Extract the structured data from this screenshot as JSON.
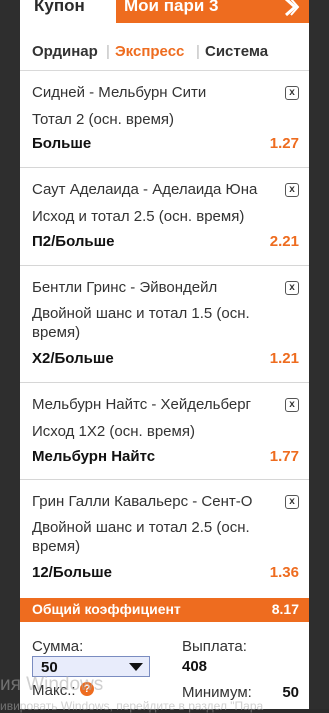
{
  "tabs": {
    "coupon": "Купон",
    "my_bets": "Мои пари 3"
  },
  "modes": {
    "single": "Ординар",
    "express": "Экспресс",
    "system": "Система",
    "active": "express"
  },
  "bets": [
    {
      "match": "Сидней - Мельбурн Сити",
      "market": "Тотал 2 (осн. время)",
      "pick": "Больше",
      "odds": "1.27"
    },
    {
      "match": "Саут Аделаида - Аделаида Юна",
      "market": "Исход и тотал 2.5 (осн. время)",
      "pick": "П2/Больше",
      "odds": "2.21"
    },
    {
      "match": "Бентли Гринс - Эйвондейл",
      "market": "Двойной шанс и тотал 1.5 (осн. время)",
      "pick": "Х2/Больше",
      "odds": "1.21"
    },
    {
      "match": "Мельбурн Найтс - Хейдельберг",
      "market": "Исход 1Х2 (осн. время)",
      "pick": "Мельбурн Найтс",
      "odds": "1.77"
    },
    {
      "match": "Грин Галли Кавальерс - Сент-О",
      "market": "Двойной шанс и тотал 2.5 (осн. время)",
      "pick": "12/Больше",
      "odds": "1.36"
    }
  ],
  "close_glyph": "x",
  "total": {
    "label": "Общий коэффициент",
    "value": "8.17"
  },
  "stake": {
    "sum_label": "Сумма:",
    "sum_value": "50",
    "payout_label": "Выплата:",
    "payout_value": "408",
    "max_label": "Макс.:",
    "min_label": "Минимум:",
    "min_value": "50",
    "help_glyph": "?"
  },
  "watermark": {
    "line1": "ия Windows",
    "line2": "ивировать Windows, перейдите в раздел \"Пара"
  },
  "colors": {
    "accent": "#ee6c1f"
  }
}
